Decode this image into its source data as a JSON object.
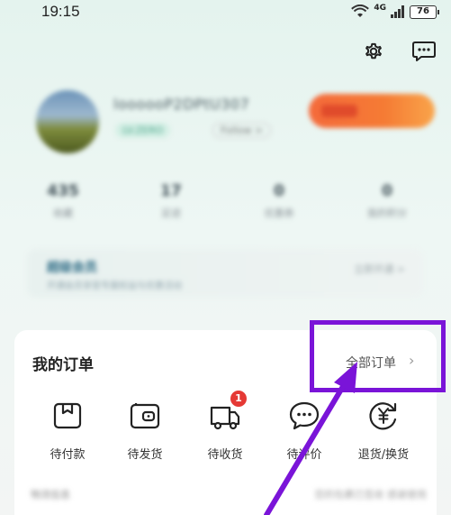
{
  "status_bar": {
    "time": "19:15",
    "network": "4G",
    "battery": "76"
  },
  "top_icons": {
    "settings": "gear-icon",
    "messages": "message-icon"
  },
  "profile": {
    "name": "loooooP2DPtU307",
    "tag_primary": "LV.ZERO",
    "tag_secondary": "Follow >"
  },
  "stats": [
    {
      "value": "435",
      "label": "收藏"
    },
    {
      "value": "17",
      "label": "足迹"
    },
    {
      "value": "0",
      "label": "优惠券"
    },
    {
      "value": "0",
      "label": "我的积分"
    }
  ],
  "member": {
    "title": "超级会员",
    "subtitle": "开通会员享受专属权益与优惠活动",
    "right": "立即开通 >"
  },
  "orders": {
    "title": "我的订单",
    "all_link": "全部订单",
    "items": [
      {
        "label": "待付款",
        "icon": "pending-payment-icon"
      },
      {
        "label": "待发货",
        "icon": "wallet-icon",
        "badge": null
      },
      {
        "label": "待收货",
        "icon": "truck-icon",
        "badge": "1"
      },
      {
        "label": "待评价",
        "icon": "chat-bubble-icon"
      },
      {
        "label": "退货/换货",
        "icon": "yuan-refund-icon"
      }
    ],
    "footer_left": "物流信息",
    "footer_right": "您的包裹已签收 感谢使用"
  },
  "colors": {
    "highlight": "#7a14d8",
    "badge": "#e53935",
    "accent_orange": "#f57b34"
  }
}
